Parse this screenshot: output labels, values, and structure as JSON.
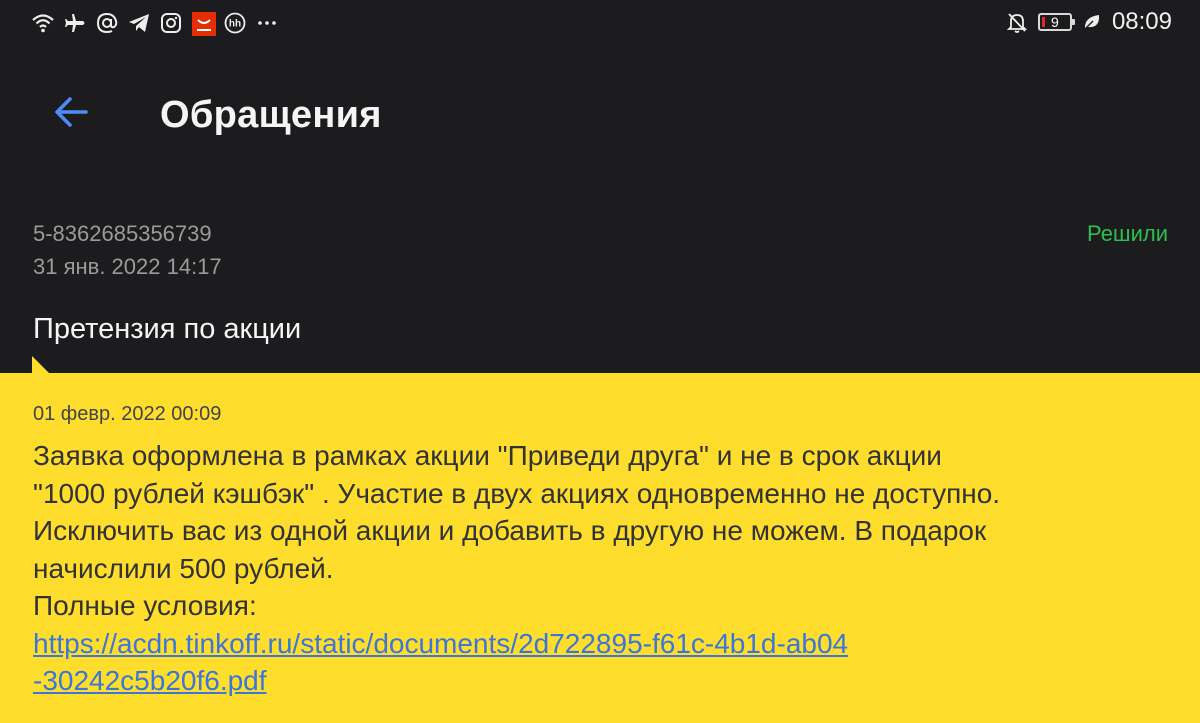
{
  "status_bar": {
    "time": "08:09",
    "battery_level": "9",
    "icons": [
      "wifi-icon",
      "airplane-icon",
      "at-icon",
      "telegram-icon",
      "instagram-icon",
      "aliexpress-icon",
      "hh-icon",
      "more-icon",
      "notifications-off-icon",
      "battery-icon",
      "leaf-icon"
    ]
  },
  "header": {
    "title": "Обращения",
    "back_icon": "arrow-left-icon"
  },
  "ticket": {
    "id": "5-8362685356739",
    "created": "31 янв. 2022 14:17",
    "status": "Решили",
    "subject": "Претензия по акции"
  },
  "message": {
    "date": "01 февр. 2022 00:09",
    "lines": [
      "Заявка оформлена в рамках акции \"Приведи друга\" и не в срок акции",
      "\"1000 рублей кэшбэк\" . Участие в двух акциях одновременно не доступно.",
      "Исключить вас из одной акции и добавить в другую не можем. В подарок",
      "начислили 500 рублей.",
      "Полные условия:"
    ],
    "link_line1": "https://acdn.tinkoff.ru/static/documents/2d722895-f61c-4b1d-ab04",
    "link_line2": "-30242c5b20f6.pdf"
  },
  "colors": {
    "background": "#1c1c1e",
    "accent_blue": "#4a8ef0",
    "status_green": "#2ebd4f",
    "bubble_yellow": "#ffdd2d"
  }
}
